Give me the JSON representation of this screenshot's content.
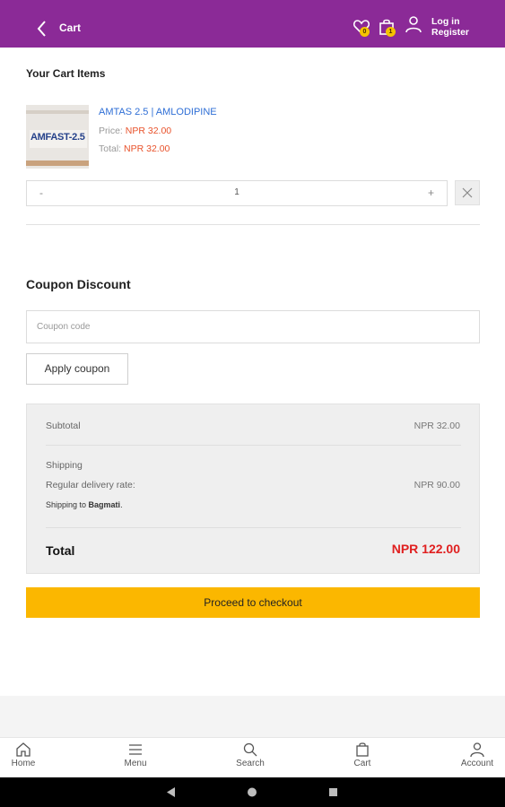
{
  "header": {
    "title": "Cart",
    "wishlist_badge": "0",
    "cart_badge": "1",
    "login_label": "Log in",
    "register_label": "Register"
  },
  "cart": {
    "heading": "Your Cart Items",
    "item": {
      "name": "AMTAS 2.5 | AMLODIPINE",
      "image_brand": "AMFAST-2.5",
      "price_label": "Price:",
      "price": "NPR 32.00",
      "total_label": "Total:",
      "total": "NPR 32.00",
      "quantity": "1",
      "minus": "-",
      "plus": "+"
    }
  },
  "coupon": {
    "heading": "Coupon Discount",
    "placeholder": "Coupon code",
    "apply_label": "Apply coupon"
  },
  "summary": {
    "subtotal_label": "Subtotal",
    "subtotal_value": "NPR 32.00",
    "shipping_label": "Shipping",
    "delivery_label": "Regular delivery rate:",
    "delivery_value": "NPR 90.00",
    "shipping_to_prefix": "Shipping to ",
    "shipping_to_place": "Bagmati",
    "shipping_to_suffix": ".",
    "total_label": "Total",
    "total_value": "NPR 122.00"
  },
  "checkout_label": "Proceed to checkout",
  "bottom_nav": [
    {
      "label": "Home",
      "icon": "home-icon"
    },
    {
      "label": "Menu",
      "icon": "menu-icon"
    },
    {
      "label": "Search",
      "icon": "search-icon"
    },
    {
      "label": "Cart",
      "icon": "cart-icon"
    },
    {
      "label": "Account",
      "icon": "account-icon"
    }
  ],
  "colors": {
    "brand": "#8b2a97",
    "accent": "#fbb700",
    "price": "#e8522b",
    "link": "#2f6fd6",
    "total": "#e02020"
  }
}
